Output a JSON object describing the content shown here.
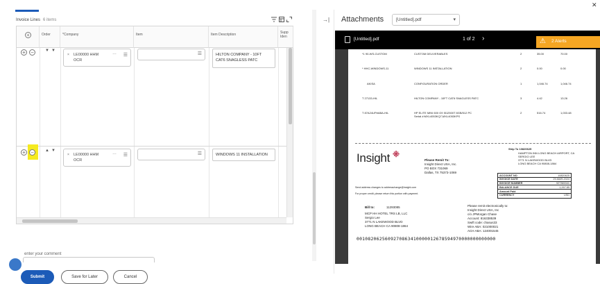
{
  "invoice_lines": {
    "title": "Invoice Lines",
    "count": "6 items",
    "columns": [
      "Order",
      "*Company",
      "Item",
      "Item Description",
      "Supp Iden"
    ],
    "rows": [
      {
        "company": "LE00000 HHM OCR",
        "item": "",
        "description": "HILTON COMPANY - 10FT CAT6 SNAGLESS PATC"
      },
      {
        "company": "LE00000 HHM OCR",
        "item": "",
        "description": "WINDOWS 11 INSTALLATION"
      }
    ]
  },
  "comment": {
    "placeholder": "enter your comment"
  },
  "buttons": {
    "submit": "Submit",
    "save_for_later": "Save for Later",
    "cancel": "Cancel"
  },
  "attachments": {
    "title": "Attachments",
    "selected_file": "[Untitled].pdf",
    "viewer": {
      "file_name": "[Untitled].pdf",
      "page_info": "1 of 2",
      "alerts": "2 Alerts"
    }
  },
  "document": {
    "line_items": [
      {
        "part": "*1 90-WS-CUSTOM",
        "desc": "CUSTOM DELIVERABLES",
        "qty": "2",
        "unit": "35.00",
        "total": "70.00"
      },
      {
        "part": "* HHC-WINDOWS-11",
        "desc": "WINDOWS 11 INSTALLATION",
        "qty": "2",
        "unit": "0.00",
        "total": "0.00"
      },
      {
        "part": "AKISA",
        "desc": "CONFIGURATION ORDER",
        "qty": "1",
        "unit": "1,046.74",
        "total": "1,046.74"
      },
      {
        "part": "T 27133-HIL",
        "desc": "HILTON COMPANY - 10FT CAT6 SNAGLESS PATC",
        "qty": "3",
        "unit": "4.42",
        "total": "13.26"
      },
      {
        "part": "T 87A24UP#ABA-HIL",
        "desc": "HP ELITE MINI 600 G9 I512500T 8GB/512 PC",
        "desc2": "Serial #:MXL4053KQ7,MXL4053KPS",
        "qty": "2",
        "unit": "516.74",
        "total": "1,033.48"
      }
    ],
    "ship_to": [
      "Ship To 10820625",
      "HAMPTON INN LONG BEACH AIRPORT, CA",
      "SERGIO LEE",
      "3771 N LAKEWOOD BLVD",
      "LONG BEACH CA 90808-1864"
    ],
    "logo": "Insight",
    "remit_to": [
      "Please Remit To:",
      "Insight Direct USA, Inc.",
      "PO BOX 731069",
      "Dallas, TX 75373-1069"
    ],
    "account_table": [
      {
        "label": "ACCOUNT NO",
        "value": "10820625"
      },
      {
        "label": "INVOICE DATE",
        "value": "29-MAR-2024"
      },
      {
        "label": "INVOICE NUMBER",
        "value": "927365341"
      },
      {
        "label": "BALANCE DUE",
        "value": "1,267.85"
      },
      {
        "label": "Amount Paid",
        "value": ""
      },
      {
        "label": "CURRENCY",
        "value": "USD"
      }
    ],
    "address_change": "Send address changes to addresschange@insight.com",
    "proper_credit": "For proper credit, please return this portion with payment.",
    "bill_to": [
      "Bill to:",
      "11293085"
    ],
    "bill_addr": [
      "MCP HH HOTEL TRS LB, LLC",
      "Sergio Lee",
      "3771 N LAKEWOOD BLVD",
      "LONG BEACH CA 90808-1864"
    ],
    "electronic": [
      "Please remit electronically to:",
      "Insight Direct USA, Inc",
      "c/o JPMorgan Chase",
      "Account: 816338539",
      "Swift code: chasus33",
      "Wire ABA: 021000021",
      "ACH ABA: 124001545"
    ],
    "barcode": "0010820625609270863410000012678594970000000000000"
  },
  "colors": {
    "primary": "#1c5bb8",
    "alert": "#f5a623",
    "highlight": "#f5ea20"
  }
}
